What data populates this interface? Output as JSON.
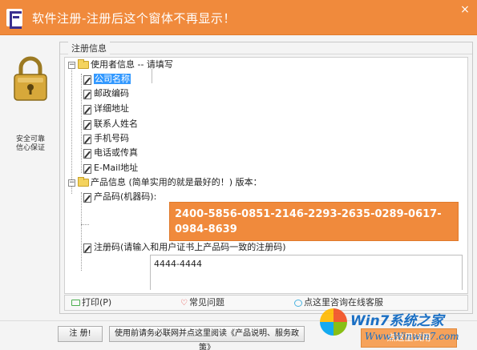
{
  "window": {
    "title": "软件注册-注册后这个窗体不再显示！",
    "close_glyph": "×"
  },
  "left_pane": {
    "label_line1": "安全可靠",
    "label_line2": "信心保证"
  },
  "group": {
    "title": "注册信息"
  },
  "tree": {
    "user_info": {
      "label": "使用者信息 -- 请填写",
      "items": [
        {
          "label": "公司名称",
          "selected": true
        },
        {
          "label": "邮政编码"
        },
        {
          "label": "详细地址"
        },
        {
          "label": "联系人姓名"
        },
        {
          "label": "手机号码"
        },
        {
          "label": "电话或传真"
        },
        {
          "label": "E-Mail地址"
        }
      ]
    },
    "product_info": {
      "label": "产品信息 (简单实用的就是最好的！) 版本：",
      "product_code_label": "产品码(机器码):",
      "product_code_value_line1": "2400-5856-0851-2146-2293-2635-0289-0617-",
      "product_code_value_line2": "0984-8639",
      "reg_code_label": "注册码(请输入和用户证书上产品码一致的注册码)",
      "reg_code_value": "4444-4444"
    }
  },
  "links": {
    "print": "打印(P)",
    "faq": "常见问题",
    "consult": "点这里咨询在线客服"
  },
  "buttons": {
    "register": "注 册!",
    "notice": "使用前请务必联网并点这里阅读《产品说明、服务政策》",
    "try": "点这里试用"
  },
  "watermark": {
    "title": "Win7系统之家",
    "url": "Www.Winwin7.com"
  },
  "colors": {
    "accent": "#f08a3c",
    "selection": "#3399ff"
  }
}
